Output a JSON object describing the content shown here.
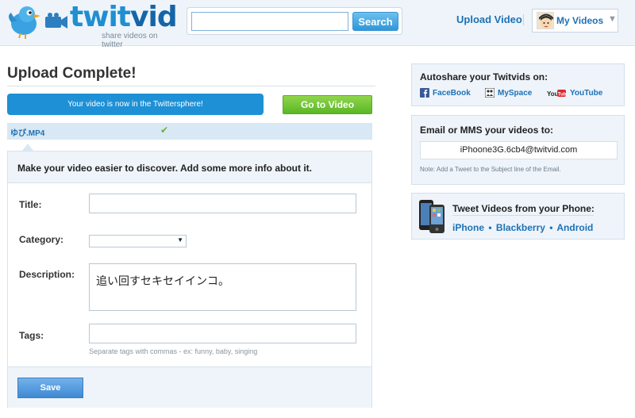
{
  "header": {
    "logo_twit": "twit",
    "logo_vid": "vid",
    "tagline": "share videos on twitter",
    "search_value": "",
    "search_button": "Search",
    "upload_link": "Upload Video",
    "my_videos": "My Videos"
  },
  "main": {
    "title": "Upload Complete!",
    "status_message": "Your video is now in the Twittersphere!",
    "go_button": "Go to Video",
    "file_name": "ゆぴ.MP4",
    "check_mark": "✔",
    "form": {
      "heading": "Make your video easier to discover. Add some more info about it.",
      "title_label": "Title:",
      "title_value": "",
      "category_label": "Category:",
      "category_value": "",
      "description_label": "Description:",
      "description_value": "追い回すセキセイインコ。",
      "tags_label": "Tags:",
      "tags_value": "",
      "tags_hint": "Separate tags with commas - ex: funny, baby, singing",
      "save_button": "Save"
    }
  },
  "sidebar": {
    "autoshare": {
      "title": "Autoshare your Twitvids on:",
      "links": [
        "FaceBook",
        "MySpace",
        "YouTube"
      ]
    },
    "email": {
      "title": "Email or MMS your videos to:",
      "address": "iPhoone3G.6cb4@twitvid.com",
      "note": "Note: Add a Tweet to the Subject line of the Email."
    },
    "phone": {
      "title": "Tweet Videos from your Phone:",
      "links": [
        "iPhone",
        "Blackberry",
        "Android"
      ],
      "separator": "•"
    }
  },
  "colors": {
    "brand_blue": "#1d71b5",
    "status_blue": "#1e90d6",
    "go_green": "#5bb724",
    "panel_bg": "#eef4fa"
  }
}
